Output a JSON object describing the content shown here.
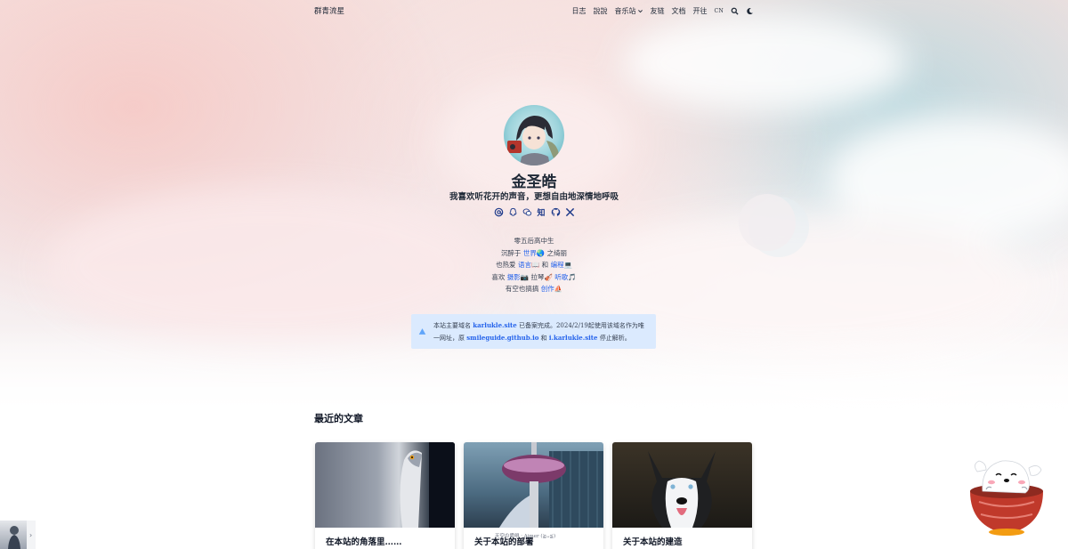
{
  "nav": {
    "brand": "群青流星",
    "items": [
      "日志",
      "說說",
      "音乐站",
      "友链",
      "文档",
      "开往"
    ],
    "lang": "CN"
  },
  "profile": {
    "name": "金圣皓",
    "tagline": "我喜欢听花开的声音，更想自由地深情地呼吸",
    "socials": [
      "email-icon",
      "qq-icon",
      "wechat-icon",
      "zhihu-icon",
      "github-icon",
      "x-icon"
    ],
    "zhihu_label": "知"
  },
  "bio": {
    "line1": "零五后高中生",
    "line2": {
      "pre": "沉醉于 ",
      "link": "世界",
      "emoji": "🌏",
      "post": " 之绮丽"
    },
    "line3": {
      "pre": "也热爱 ",
      "link1": "语言",
      "emoji1": "📖",
      "mid": " 和 ",
      "link2": "编程",
      "emoji2": "💻"
    },
    "line4": {
      "pre": "喜欢 ",
      "link1": "摄影",
      "emoji1": "📷",
      "mid": " 拉琴",
      "emoji_mid": "🎻",
      "link2": " 听歌",
      "emoji2": "🎵"
    },
    "line5": {
      "pre": "有空也搞搞 ",
      "link": "创作",
      "emoji": "⛵"
    }
  },
  "notice": {
    "p1": "本站主要域名 ",
    "d1": "karlukle.site",
    "p2": " 已备案完成。2024/2/19起使用该域名作为唯一网址，原 ",
    "d2": "smileguide.github.io",
    "p3": " 和 ",
    "d3": "i.karlukle.site",
    "p4": " 停止解析。"
  },
  "recent": {
    "title": "最近的文章",
    "cards": [
      {
        "title": "在本站的角落里……"
      },
      {
        "title": "关于本站的部署"
      },
      {
        "title": "关于本站的建造"
      }
    ],
    "music_caption": "天空の愛唄 · Aimer (≧ᴗ≦)"
  },
  "colors": {
    "accent": "#2563eb",
    "notice_bg": "#dbeafe",
    "text": "#1f2937"
  }
}
